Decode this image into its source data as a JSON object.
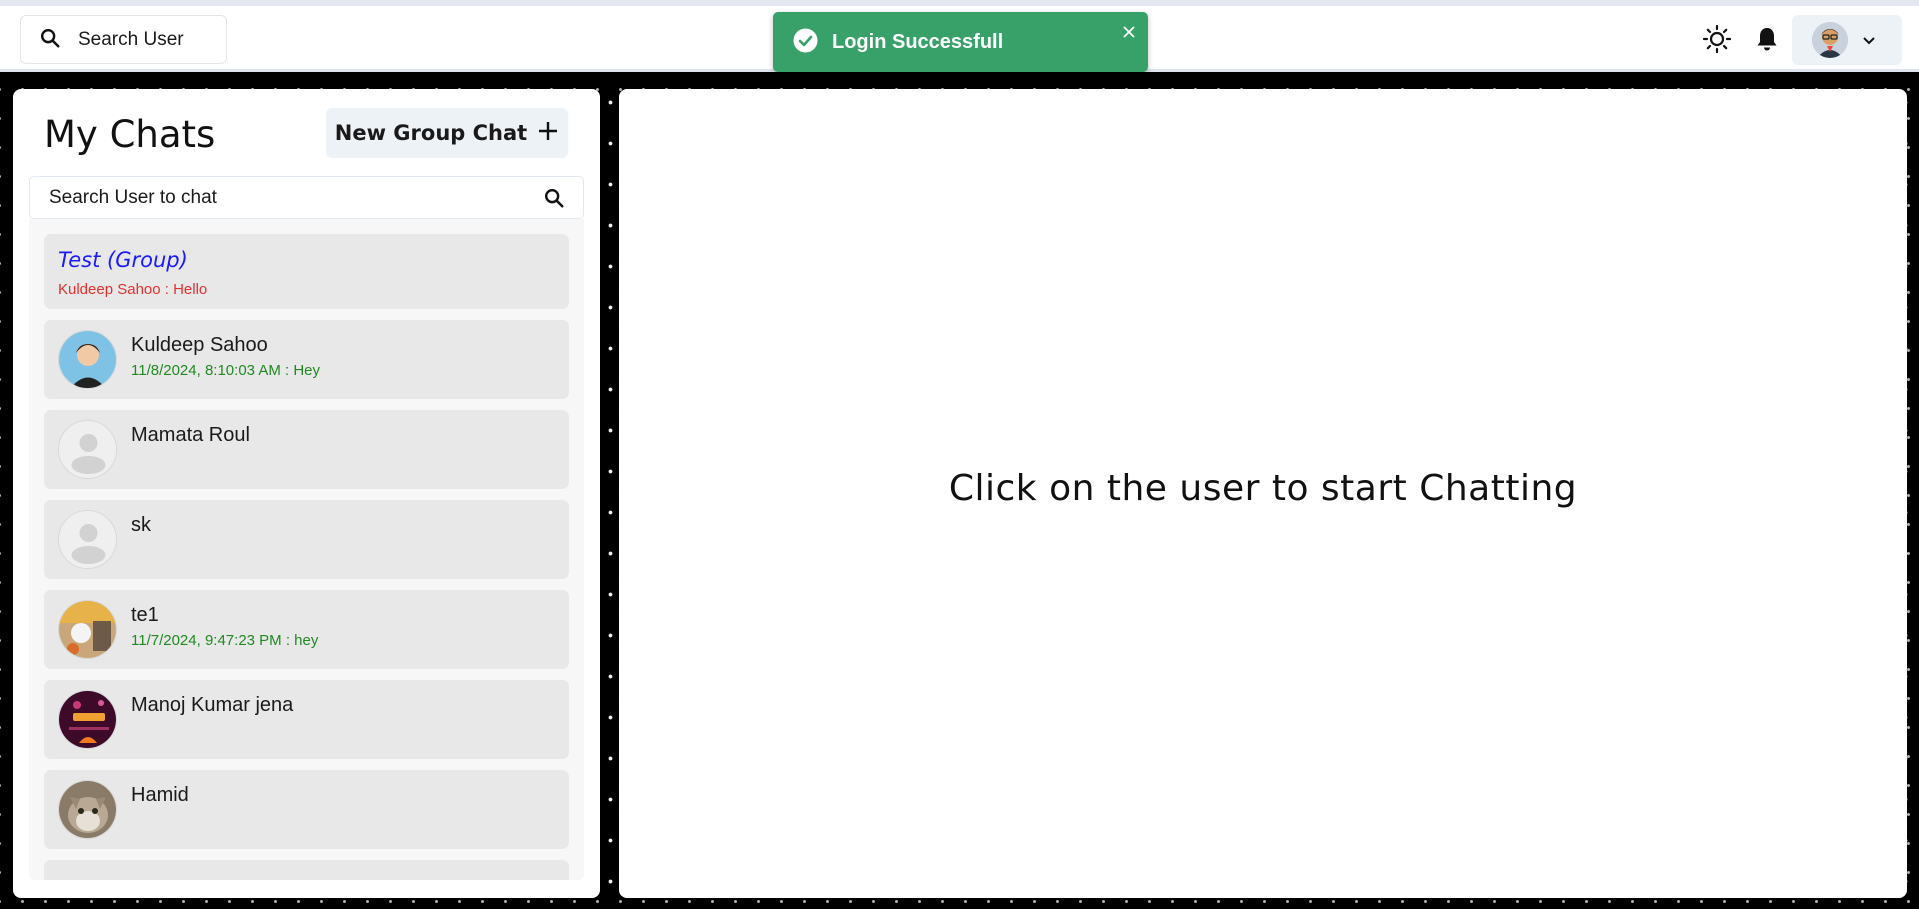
{
  "header": {
    "search_label": "Search User",
    "icons": {
      "search": "search-icon",
      "theme": "sun-icon",
      "notifications": "bell-icon",
      "profile_menu": "chevron-down-icon"
    }
  },
  "toast": {
    "message": "Login Successfull",
    "status": "success",
    "color": "#38a169"
  },
  "sidebar": {
    "title": "My Chats",
    "new_group_label": "New Group Chat",
    "search_placeholder": "Search User to chat",
    "chats": [
      {
        "type": "group",
        "name": "Test (Group)",
        "latest": "Kuldeep Sahoo : Hello"
      },
      {
        "type": "user",
        "name": "Kuldeep Sahoo",
        "latest": "11/8/2024, 8:10:03 AM : Hey",
        "avatar": "photo"
      },
      {
        "type": "user",
        "name": "Mamata Roul",
        "latest": "",
        "avatar": "default"
      },
      {
        "type": "user",
        "name": "sk",
        "latest": "",
        "avatar": "default"
      },
      {
        "type": "user",
        "name": "te1",
        "latest": "11/7/2024, 9:47:23 PM : hey",
        "avatar": "photo"
      },
      {
        "type": "user",
        "name": "Manoj Kumar jena",
        "latest": "",
        "avatar": "photo"
      },
      {
        "type": "user",
        "name": "Hamid",
        "latest": "",
        "avatar": "photo"
      }
    ]
  },
  "main": {
    "empty_message": "Click on the user to start Chatting"
  }
}
